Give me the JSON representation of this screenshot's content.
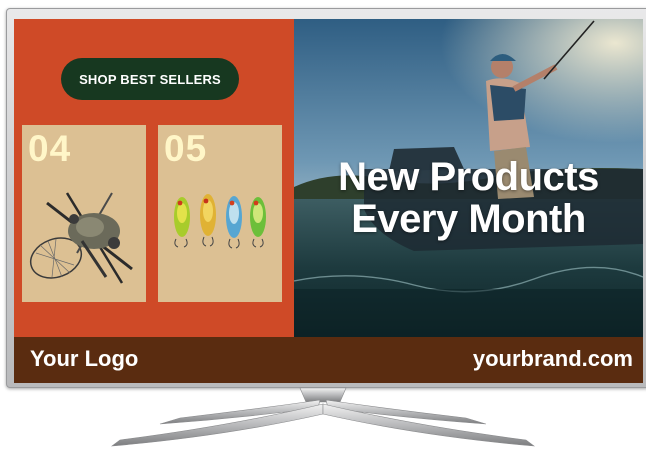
{
  "cta": {
    "label": "SHOP BEST SELLERS"
  },
  "cards": [
    {
      "number": "04",
      "image": "fishing-net-and-rods"
    },
    {
      "number": "05",
      "image": "fishing-lures"
    }
  ],
  "hero": {
    "headline_line1": "New Products",
    "headline_line2": "Every Month",
    "image": "angler-on-boat-photo"
  },
  "footer": {
    "logo_text": "Your Logo",
    "url_text": "yourbrand.com"
  },
  "colors": {
    "panel_orange": "#cf4a27",
    "cta_green": "#173820",
    "card_tan": "#dcc093",
    "number_cream": "#fff6c8",
    "footer_brown": "#5a2c10"
  }
}
